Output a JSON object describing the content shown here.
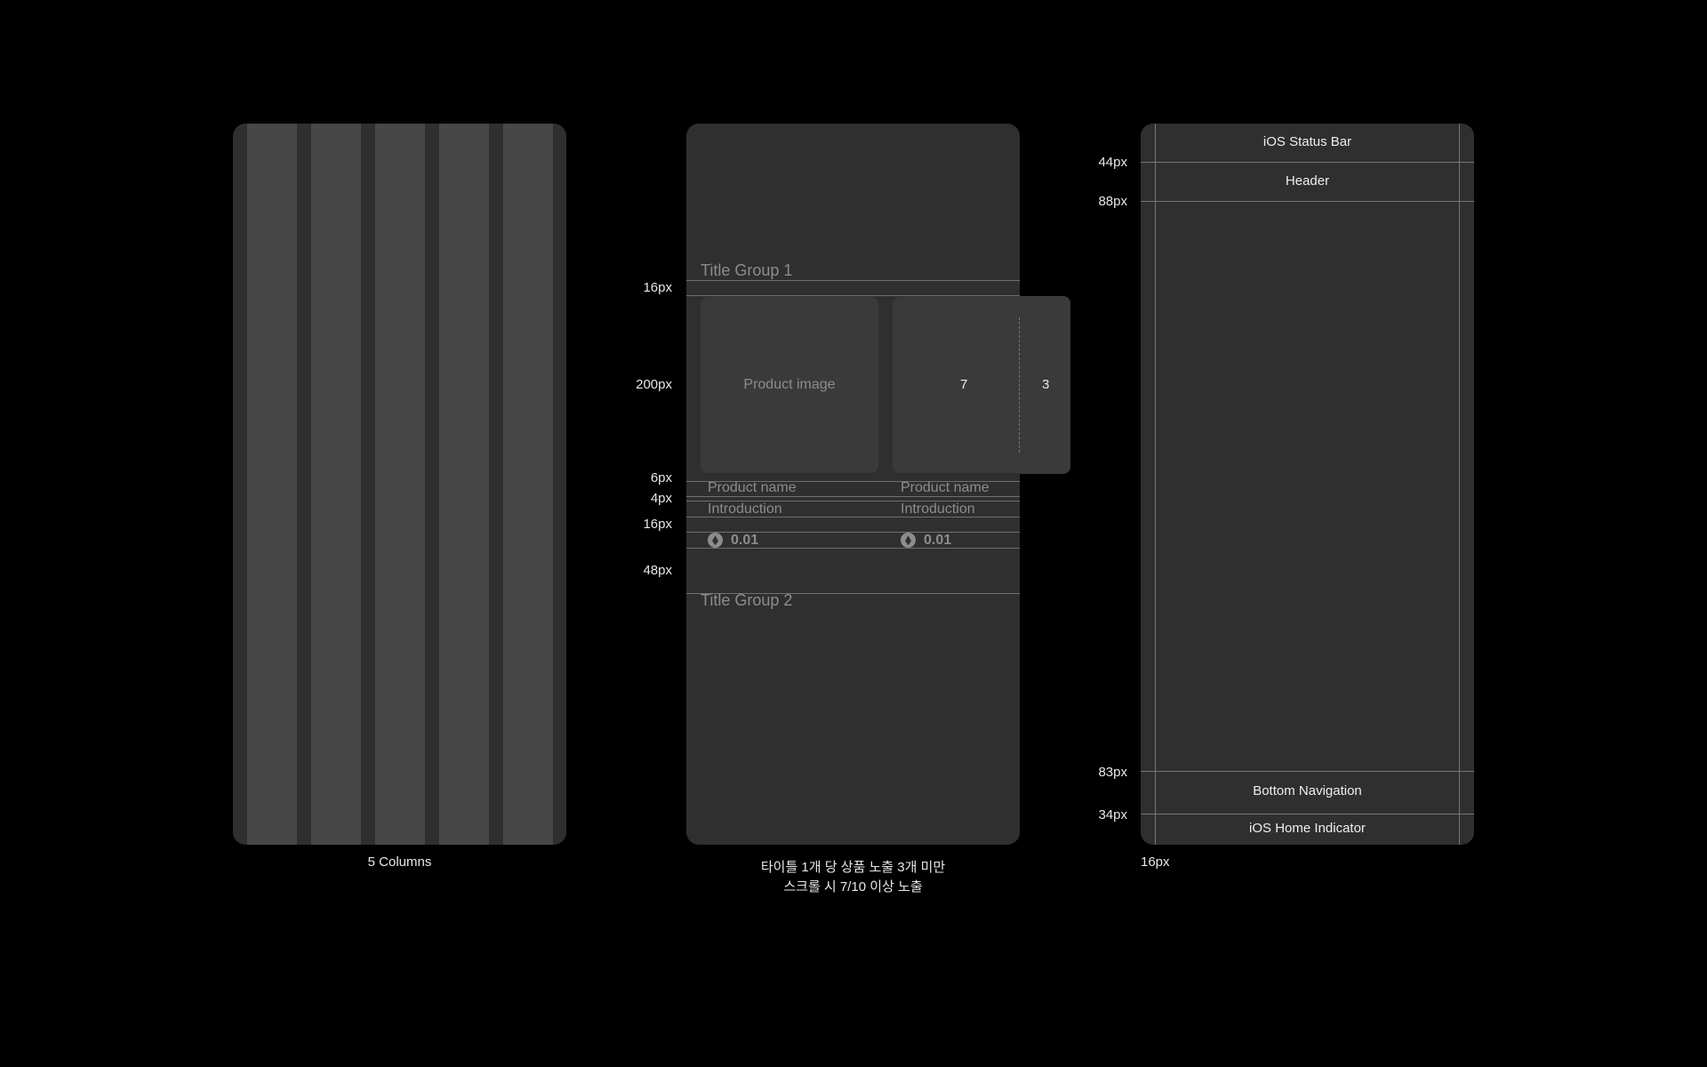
{
  "left_panel": {
    "caption": "5 Columns",
    "column_count": 5
  },
  "middle_panel": {
    "title_group_1": "Title Group 1",
    "title_group_2": "Title Group 2",
    "product_image_label": "Product image",
    "visible_count": "7",
    "partial_count": "3",
    "products": [
      {
        "name": "Product name",
        "intro": "Introduction",
        "price": "0.01",
        "price_icon": "ethereum-icon"
      },
      {
        "name": "Product name",
        "intro": "Introduction",
        "price": "0.01",
        "price_icon": "ethereum-icon"
      }
    ],
    "measurements": [
      "16px",
      "200px",
      "6px",
      "4px",
      "16px",
      "48px"
    ],
    "caption_line_1": "타이틀 1개 당 상품 노출 3개 미만",
    "caption_line_2": "스크롤 시 7/10 이상 노출"
  },
  "right_panel": {
    "status_bar": "iOS Status Bar",
    "header": "Header",
    "bottom_nav": "Bottom Navigation",
    "home_indicator": "iOS Home Indicator",
    "measurements": [
      "44px",
      "88px",
      "83px",
      "34px"
    ],
    "side_margin": "16px"
  },
  "colors": {
    "background": "#000000",
    "panel": "#2f2f2f",
    "column": "#474747",
    "card": "#3a3a3a",
    "ghost_text": "#8c8c8c"
  }
}
